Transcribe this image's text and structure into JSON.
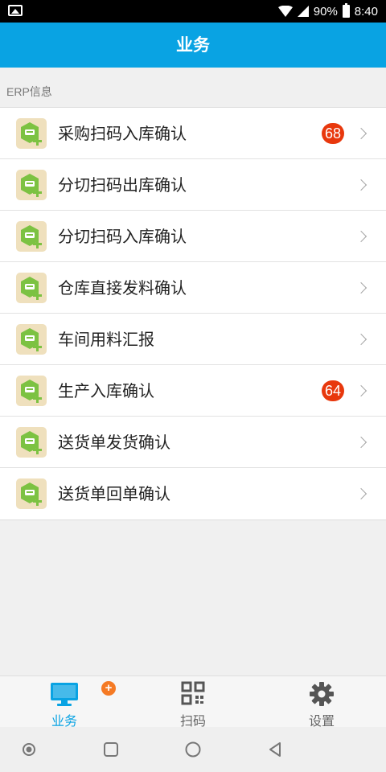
{
  "status_bar": {
    "battery": "90%",
    "time": "8:40"
  },
  "header": {
    "title": "业务"
  },
  "section": {
    "label": "ERP信息"
  },
  "items": [
    {
      "label": "采购扫码入库确认",
      "badge": "68",
      "icon": "erp-module-icon"
    },
    {
      "label": "分切扫码出库确认",
      "badge": "",
      "icon": "erp-module-icon"
    },
    {
      "label": "分切扫码入库确认",
      "badge": "",
      "icon": "erp-module-icon"
    },
    {
      "label": "仓库直接发料确认",
      "badge": "",
      "icon": "erp-module-icon"
    },
    {
      "label": "车间用料汇报",
      "badge": "",
      "icon": "erp-module-icon"
    },
    {
      "label": "生产入库确认",
      "badge": "64",
      "icon": "erp-module-icon"
    },
    {
      "label": "送货单发货确认",
      "badge": "",
      "icon": "erp-module-icon"
    },
    {
      "label": "送货单回单确认",
      "badge": "",
      "icon": "erp-module-icon"
    }
  ],
  "tabbar": {
    "tabs": [
      {
        "label": "业务",
        "icon": "monitor-icon",
        "active": true
      },
      {
        "label": "扫码",
        "icon": "qr-code-icon",
        "active": false
      },
      {
        "label": "设置",
        "icon": "gear-icon",
        "active": false
      }
    ],
    "notify_symbol": "+"
  },
  "colors": {
    "accent": "#09a3e3",
    "badge": "#e8380d",
    "icon_green": "#7cc242",
    "icon_bg": "#efe0bd",
    "tab_dot": "#f57a24"
  }
}
